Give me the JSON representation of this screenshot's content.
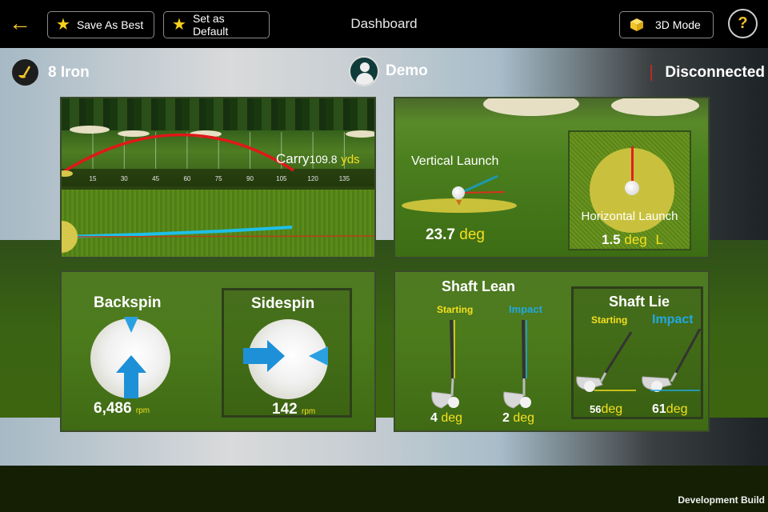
{
  "topbar": {
    "back_icon": "arrow-left-icon",
    "save_as_best": "Save As Best",
    "set_as_default": "Set as Default",
    "title": "Dashboard",
    "mode_3d": "3D Mode",
    "help": "?"
  },
  "status": {
    "club": "8 Iron",
    "user": "Demo",
    "connection": "Disconnected"
  },
  "trajectory": {
    "ticks": [
      "15",
      "30",
      "45",
      "60",
      "75",
      "90",
      "105",
      "120",
      "135"
    ],
    "carry_label": "Carry",
    "carry_value": "109.8",
    "carry_unit": "yds"
  },
  "launch": {
    "vertical_title": "Vertical Launch",
    "vertical_value": "23.7",
    "vertical_unit": "deg",
    "horizontal_title": "Horizontal Launch",
    "horizontal_value": "1.5",
    "horizontal_unit": "deg",
    "horizontal_direction": "L"
  },
  "spin": {
    "backspin_title": "Backspin",
    "backspin_value": "6,486",
    "backspin_unit": "rpm",
    "sidespin_title": "Sidespin",
    "sidespin_value": "142",
    "sidespin_unit": "rpm"
  },
  "shaft": {
    "lean_title": "Shaft Lean",
    "lean_starting_label": "Starting",
    "lean_impact_label": "Impact",
    "lean_starting_value": "4",
    "lean_impact_value": "2",
    "lean_unit": "deg",
    "lie_title": "Shaft Lie",
    "lie_starting_label": "Starting",
    "lie_impact_label": "Impact",
    "lie_starting_value": "56",
    "lie_impact_value": "61",
    "lie_unit": "deg"
  },
  "footer": {
    "build_label": "Development Build"
  },
  "colors": {
    "accent_yellow": "#f4e01c",
    "impact_blue": "#22a8e0",
    "trajectory_red": "#e01818"
  }
}
